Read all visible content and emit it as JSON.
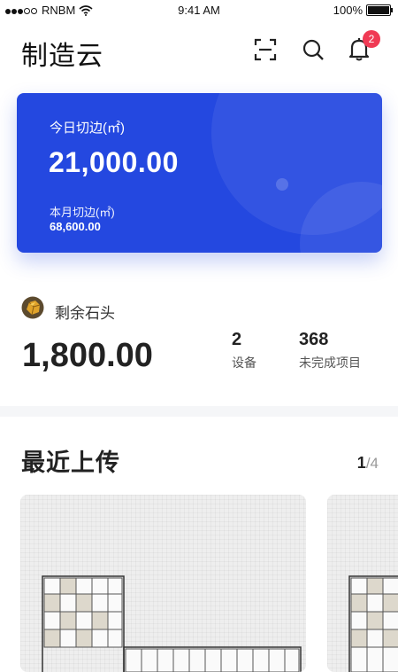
{
  "status_bar": {
    "carrier": "RNBM",
    "time": "9:41 AM",
    "battery": "100%"
  },
  "header": {
    "title": "制造云",
    "icons": [
      "scan-icon",
      "search-icon",
      "bell-icon"
    ],
    "notification_count": "2"
  },
  "card": {
    "today_label": "今日切边(㎡)",
    "today_value": "21,000.00",
    "month_label": "本月切边(㎡)",
    "month_value": "68,600.00",
    "color": "#2448e0"
  },
  "stone": {
    "label": "剩余石头",
    "value": "1,800.00",
    "stats": [
      {
        "value": "2",
        "label": "设备"
      },
      {
        "value": "368",
        "label": "未完成项目"
      }
    ]
  },
  "recent": {
    "title": "最近上传",
    "page_current": "1",
    "page_total": "/4"
  },
  "colors": {
    "badge": "#f03a54",
    "background": "#ffffff"
  }
}
